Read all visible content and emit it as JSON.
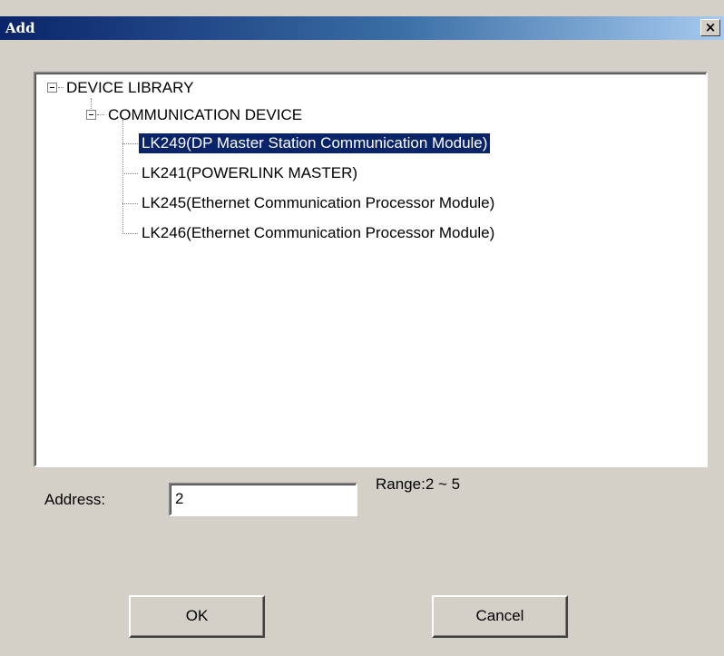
{
  "dialog": {
    "title": "Add",
    "close_glyph": "×"
  },
  "tree": {
    "root": {
      "label": "DEVICE LIBRARY",
      "expanded": true
    },
    "category": {
      "label": "COMMUNICATION DEVICE",
      "expanded": true
    },
    "items": [
      {
        "label": "LK249(DP Master Station Communication Module)",
        "selected": true
      },
      {
        "label": "LK241(POWERLINK MASTER)",
        "selected": false
      },
      {
        "label": "LK245(Ethernet Communication Processor Module)",
        "selected": false
      },
      {
        "label": "LK246(Ethernet Communication Processor Module)",
        "selected": false
      }
    ]
  },
  "address": {
    "label": "Address:",
    "value": "2",
    "range": "Range:2 ~ 5"
  },
  "buttons": {
    "ok": "OK",
    "cancel": "Cancel"
  },
  "colors": {
    "selection": "#0a246a",
    "face": "#d4d0c8"
  }
}
